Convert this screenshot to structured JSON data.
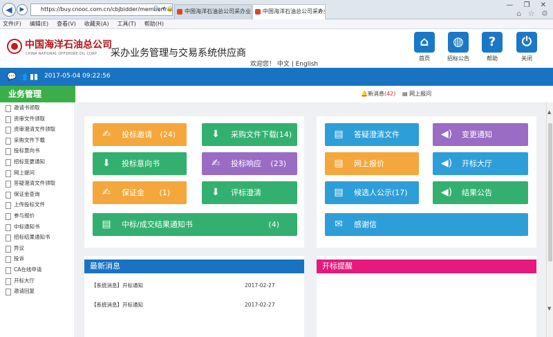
{
  "browser": {
    "address": "https://buy.cnooc.com.cn/cbjbidder/memberfram",
    "address_controls": "🔍 ▾ 🔒 C",
    "tabs": [
      {
        "label": "中国海洋石油总公司采办业..."
      },
      {
        "label": "中国海洋石油总公司采办业..."
      }
    ],
    "window_controls": "— ❐ ✕",
    "toolbar_icons": "⌂ ☆ ⚙"
  },
  "menubar": [
    "文件(F)",
    "编辑(E)",
    "查看(V)",
    "收藏夹(A)",
    "工具(T)",
    "帮助(H)"
  ],
  "header": {
    "company": "中国海洋石油总公司",
    "company_en": "CHINA NATIONAL OFFSHORE OIL CORP.",
    "system_title": "采办业务管理与交易系统供应商",
    "welcome": "欢迎您！ 中文 | English",
    "buttons": [
      {
        "label": "首页",
        "icon": "home-icon",
        "glyph": "⌂"
      },
      {
        "label": "招标公告",
        "icon": "globe-icon",
        "glyph": "◍"
      },
      {
        "label": "帮助",
        "icon": "help-icon",
        "glyph": "?"
      },
      {
        "label": "关闭",
        "icon": "power-icon",
        "glyph": "⏻"
      }
    ]
  },
  "bluebar": {
    "datetime": "2017-05-04 09:22:56",
    "icons": [
      "chat-icon",
      "users-icon",
      "book-icon"
    ]
  },
  "notice": {
    "new_msg_label": "新消息",
    "new_msg_count": "(42)",
    "online_inquiry": "网上报问"
  },
  "sidebar": {
    "title": "业务管理",
    "items": [
      "邀请书领取",
      "资审文件领取",
      "资审澄清文件领取",
      "采购文件下载",
      "投标意向书",
      "招标变更通知",
      "网上提问",
      "答疑澄清文件领取",
      "保证金查询",
      "上传投标文件",
      "参与报价",
      "中标通知书",
      "招标结果通知书",
      "异议",
      "投诉",
      "CA在线申请",
      "开标大厅",
      "邀请回复"
    ]
  },
  "tiles_left": [
    {
      "label": "投标邀请",
      "count": "(24)",
      "color": "orange",
      "icon": "handshake-icon",
      "glyph": "✍"
    },
    {
      "label": "采购文件下载",
      "count": "(14)",
      "color": "green",
      "icon": "download-icon",
      "glyph": "⬇"
    },
    {
      "label": "投标意向书",
      "count": "",
      "color": "green",
      "icon": "download-icon",
      "glyph": "⬇"
    },
    {
      "label": "投标响应",
      "count": "(23)",
      "color": "purple",
      "icon": "handshake-icon",
      "glyph": "✍"
    },
    {
      "label": "保证金",
      "count": "(1)",
      "color": "orange",
      "icon": "handshake-icon",
      "glyph": "✍"
    },
    {
      "label": "评标澄清",
      "count": "",
      "color": "green",
      "icon": "download-icon",
      "glyph": "⬇"
    },
    {
      "label": "中标/成交结果通知书",
      "count": "(4)",
      "color": "green",
      "icon": "clipboard-icon",
      "glyph": "▤"
    }
  ],
  "tiles_right": [
    {
      "label": "答疑澄清文件",
      "count": "",
      "color": "blue",
      "icon": "document-icon",
      "glyph": "▤"
    },
    {
      "label": "变更通知",
      "count": "",
      "color": "purple",
      "icon": "speaker-icon",
      "glyph": "◀)"
    },
    {
      "label": "网上报价",
      "count": "",
      "color": "orange",
      "icon": "document-icon",
      "glyph": "▤"
    },
    {
      "label": "开标大厅",
      "count": "",
      "color": "blue",
      "icon": "speaker-icon",
      "glyph": "◀)"
    },
    {
      "label": "候选人公示(17)",
      "count": "",
      "color": "blue",
      "icon": "document-icon",
      "glyph": "▤"
    },
    {
      "label": "结果公告",
      "count": "",
      "color": "green",
      "icon": "speaker-icon",
      "glyph": "◀)"
    },
    {
      "label": "感谢信",
      "count": "",
      "color": "blue",
      "icon": "envelope-icon",
      "glyph": "✉"
    }
  ],
  "latest": {
    "title": "最新消息",
    "rows": [
      {
        "text": "【系统消息】开标通知",
        "date": "2017-02-27"
      },
      {
        "text": "【系统消息】开标通知",
        "date": "2017-02-27"
      }
    ]
  },
  "bid_reminder": {
    "title": "开标提醒"
  },
  "colors": {
    "orange": "#f3a73c",
    "green": "#33b06f",
    "purple": "#9a6cc4",
    "blue": "#2e9ed8",
    "header_blue": "#1a73c2",
    "sidebar_green": "#3cae49",
    "latest_blue": "#1a73c2",
    "reminder_pink": "#e5197f"
  }
}
